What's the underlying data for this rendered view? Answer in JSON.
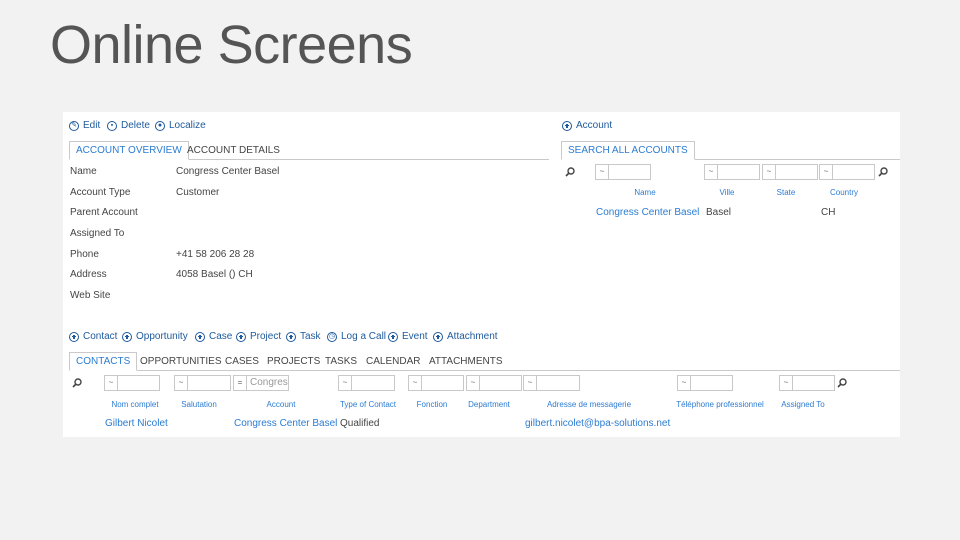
{
  "slide_title": "Online Screens",
  "account_toolbar": {
    "edit": "Edit",
    "delete": "Delete",
    "localize": "Localize"
  },
  "account_tabs": [
    "ACCOUNT OVERVIEW",
    "ACCOUNT DETAILS"
  ],
  "account_fields": [
    {
      "label": "Name",
      "value": "Congress Center Basel"
    },
    {
      "label": "Account Type",
      "value": "Customer"
    },
    {
      "label": "Parent Account",
      "value": ""
    },
    {
      "label": "Assigned To",
      "value": ""
    },
    {
      "label": "Phone",
      "value": "+41 58 206 28 28"
    },
    {
      "label": "Address",
      "value": "4058 Basel () CH"
    },
    {
      "label": "Web Site",
      "value": ""
    }
  ],
  "search_panel": {
    "add_label": "Account",
    "tab": "SEARCH ALL ACCOUNTS",
    "operator": "~",
    "columns": [
      "Name",
      "Ville",
      "State",
      "Country"
    ],
    "row": {
      "name": "Congress Center Basel",
      "ville": "Basel",
      "state": "",
      "country": "CH"
    }
  },
  "related_toolbar": [
    "Contact",
    "Opportunity",
    "Case",
    "Project",
    "Task",
    "Log a Call",
    "Event",
    "Attachment"
  ],
  "related_tabs": [
    "CONTACTS",
    "OPPORTUNITIES",
    "CASES",
    "PROJECTS",
    "TASKS",
    "CALENDAR",
    "ATTACHMENTS"
  ],
  "contacts": {
    "operator": "~",
    "account_filter_operator": "=",
    "account_filter_value": "Congres",
    "columns": [
      "Nom complet",
      "Salutation",
      "Account",
      "Type of Contact",
      "Fonction",
      "Department",
      "Adresse de messagerie",
      "Téléphone professionnel",
      "Assigned To"
    ],
    "row": {
      "nom": "Gilbert Nicolet",
      "salutation": "",
      "account": "Congress Center Basel",
      "type": "Qualified",
      "email": "gilbert.nicolet@bpa-solutions.net"
    }
  },
  "colors": {
    "link": "#2b7cd3",
    "icon": "#1e5a9c",
    "title": "#555555",
    "background": "#f2f2f2"
  }
}
